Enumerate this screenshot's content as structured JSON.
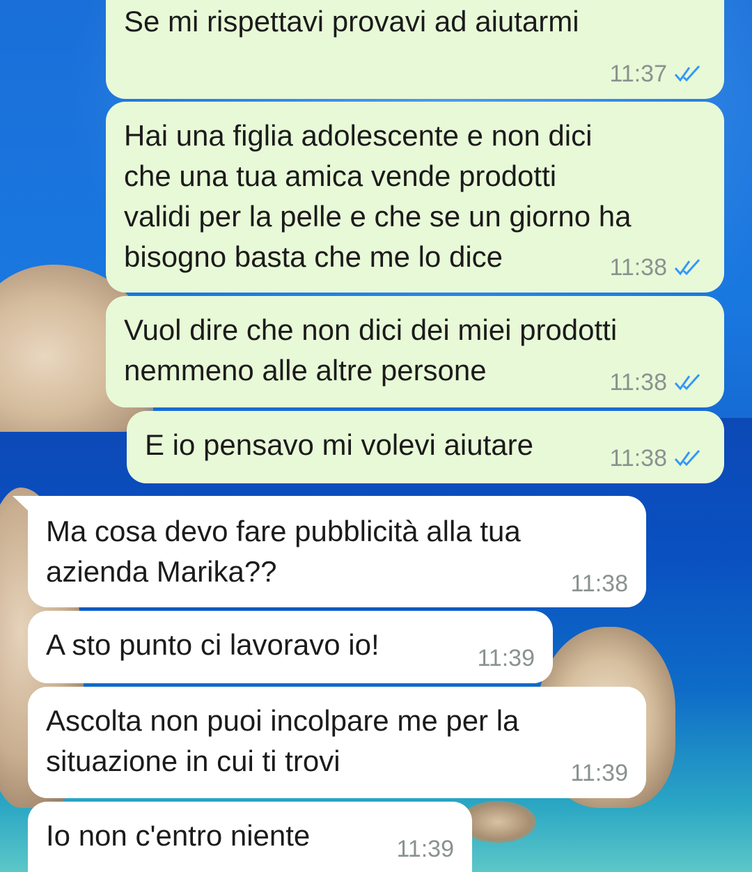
{
  "messages": [
    {
      "direction": "outgoing",
      "text": "Se mi rispettavi provavi ad aiutarmi",
      "time": "11:37",
      "status": "read"
    },
    {
      "direction": "outgoing",
      "text": "Hai una figlia adolescente e non dici\nche una tua amica vende prodotti\nvalidi per la pelle e che se un giorno ha\nbisogno basta che me lo dice",
      "time": "11:38",
      "status": "read"
    },
    {
      "direction": "outgoing",
      "text": "Vuol dire che non dici dei miei prodotti\nnemmeno alle altre persone",
      "time": "11:38",
      "status": "read"
    },
    {
      "direction": "outgoing",
      "text": "E io pensavo mi volevi aiutare",
      "time": "11:38",
      "status": "read"
    },
    {
      "direction": "incoming",
      "text": "Ma cosa devo fare pubblicità alla tua\nazienda Marika??",
      "time": "11:38"
    },
    {
      "direction": "incoming",
      "text": "A sto punto ci lavoravo io!",
      "time": "11:39"
    },
    {
      "direction": "incoming",
      "text": "Ascolta non puoi incolpare me per la\nsituazione in cui ti trovi",
      "time": "11:39"
    },
    {
      "direction": "incoming",
      "text": "Io non c'entro niente",
      "time": "11:39"
    }
  ],
  "colors": {
    "outgoing_bubble": "#e8f9d7",
    "incoming_bubble": "#ffffff",
    "read_ticks": "#3497f9",
    "timestamp": "#8a9290"
  },
  "icons": {
    "read_receipt": "double-check-icon"
  }
}
